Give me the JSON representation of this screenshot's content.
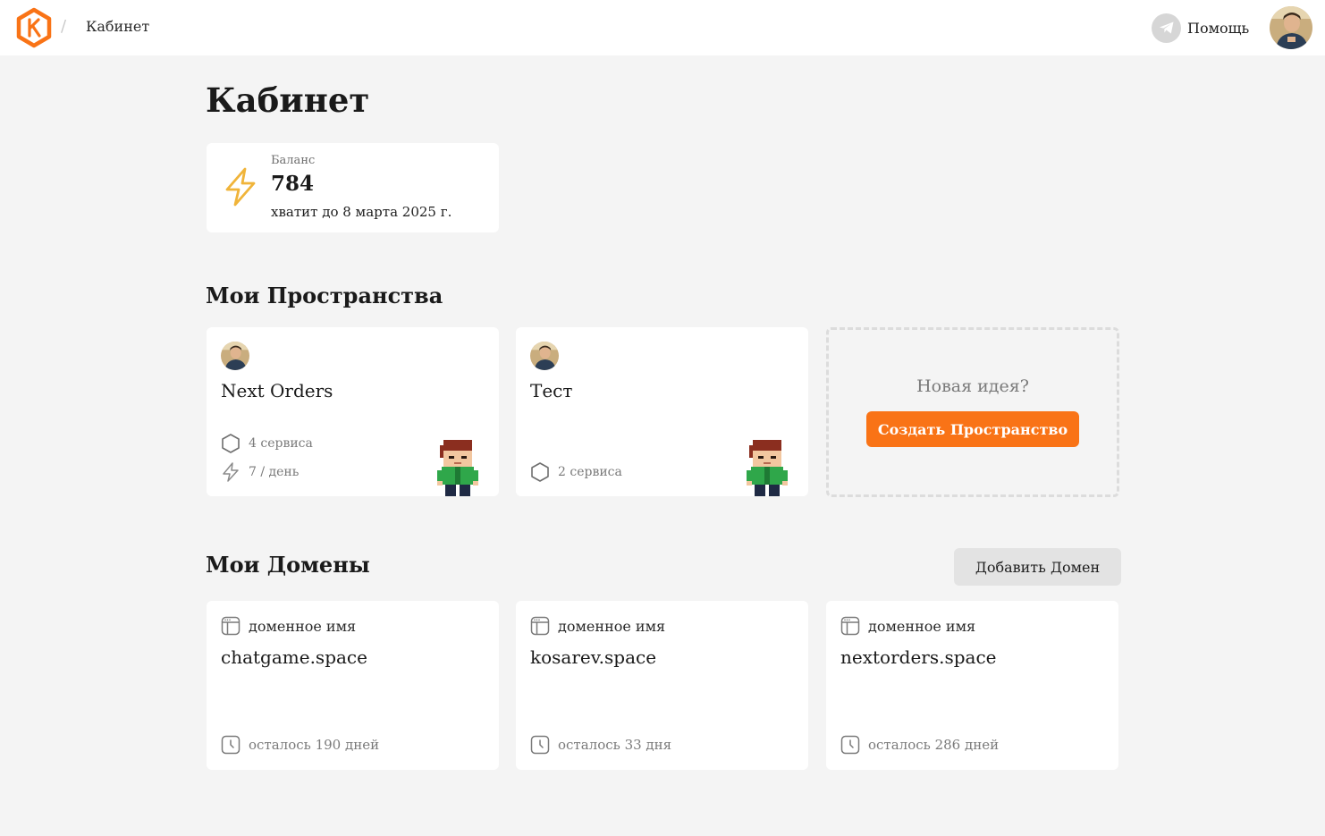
{
  "header": {
    "breadcrumb": "Кабинет",
    "separator": "/",
    "help_label": "Помощь",
    "icons": {
      "logo": "k-hexagon-logo",
      "help": "telegram-icon",
      "avatar": "user-avatar"
    }
  },
  "page": {
    "title": "Кабинет"
  },
  "balance": {
    "label": "Баланс",
    "value": "784",
    "note": "хватит до 8 марта 2025 г.",
    "icon": "lightning-icon",
    "accent": "#f0b43a"
  },
  "spaces": {
    "title": "Мои Пространства",
    "items": [
      {
        "name": "Next Orders",
        "services": "4 сервиса",
        "usage": "7 / день"
      },
      {
        "name": "Тест",
        "services": "2 сервиса"
      }
    ],
    "new_card": {
      "prompt": "Новая идея?",
      "button_label": "Создать Пространство"
    }
  },
  "domains": {
    "title": "Мои Домены",
    "add_button_label": "Добавить Домен",
    "items": [
      {
        "label": "доменное имя",
        "name": "chatgame.space",
        "expires": "осталось 190 дней"
      },
      {
        "label": "доменное имя",
        "name": "kosarev.space",
        "expires": "осталось 33 дня"
      },
      {
        "label": "доменное имя",
        "name": "nextorders.space",
        "expires": "осталось 286 дней"
      }
    ]
  },
  "colors": {
    "accent": "#f97316",
    "background": "#f4f4f4",
    "card": "#ffffff"
  }
}
